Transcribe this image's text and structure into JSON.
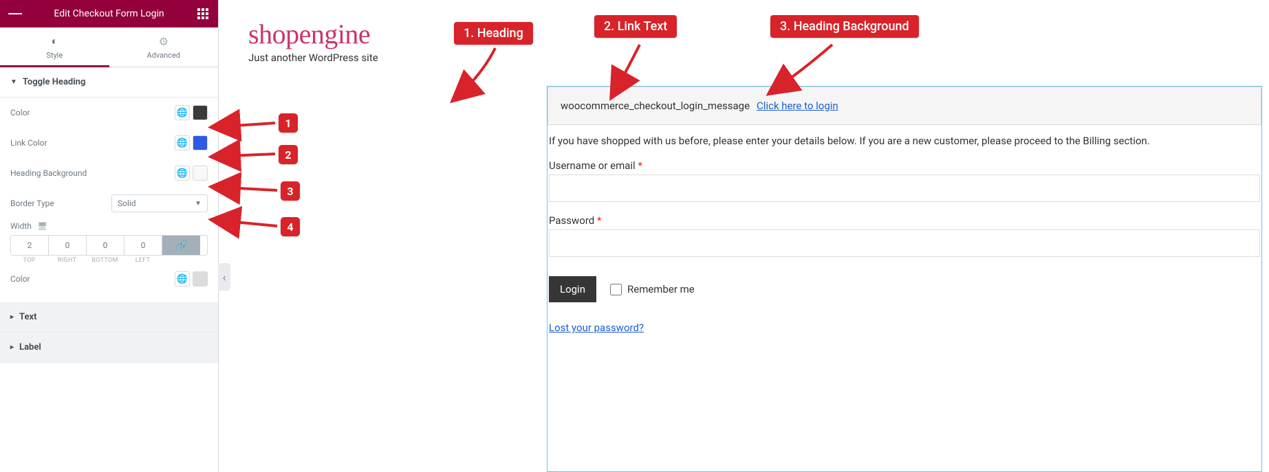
{
  "panel": {
    "title": "Edit Checkout Form Login",
    "tabs": {
      "style": "Style",
      "advanced": "Advanced"
    },
    "sections": {
      "toggle_heading": "Toggle Heading",
      "text": "Text",
      "label": "Label"
    },
    "controls": {
      "color_label": "Color",
      "link_color_label": "Link Color",
      "heading_bg_label": "Heading Background",
      "border_type_label": "Border Type",
      "border_type_value": "Solid",
      "width_label": "Width",
      "dims": {
        "top": "2",
        "right": "0",
        "bottom": "0",
        "left": "0"
      },
      "dims_sub": {
        "top": "TOP",
        "right": "RIGHT",
        "bottom": "BOTTOM",
        "left": "LEFT"
      },
      "second_color_label": "Color"
    },
    "colors": {
      "color_hex": "#3a3a3a",
      "link_color_hex": "#2d5ae0",
      "heading_bg_hex": "#f8f8f8",
      "second_color_hex": "#dcdcdc"
    }
  },
  "preview": {
    "brand": "shopengine",
    "tagline": "Just another WordPress site",
    "login_message_text": "woocommerce_checkout_login_message",
    "login_link_text": "Click here to login",
    "intro": "If you have shopped with us before, please enter your details below. If you are a new customer, please proceed to the Billing section.",
    "username_label": "Username or email",
    "password_label": "Password",
    "required_mark": "*",
    "login_button": "Login",
    "remember_label": "Remember me",
    "lost_password": "Lost your password?"
  },
  "annotations": {
    "heading": "1. Heading",
    "link_text": "2. Link Text",
    "heading_bg": "3. Heading Background",
    "n1": "1",
    "n2": "2",
    "n3": "3",
    "n4": "4"
  }
}
